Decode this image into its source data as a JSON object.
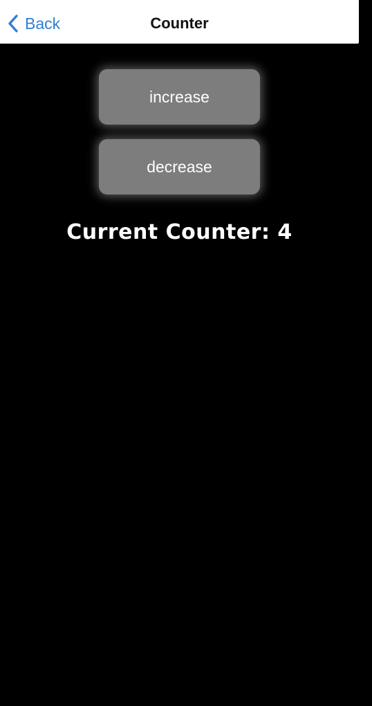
{
  "navbar": {
    "back_label": "Back",
    "back_icon": "chevron-left-icon",
    "title": "Counter",
    "accent_color": "#2f7fd6"
  },
  "controls": {
    "increase_label": "increase",
    "decrease_label": "decrease",
    "button_color": "#7d7d7d"
  },
  "counter": {
    "label": "Current Counter: 4",
    "value": 4
  }
}
